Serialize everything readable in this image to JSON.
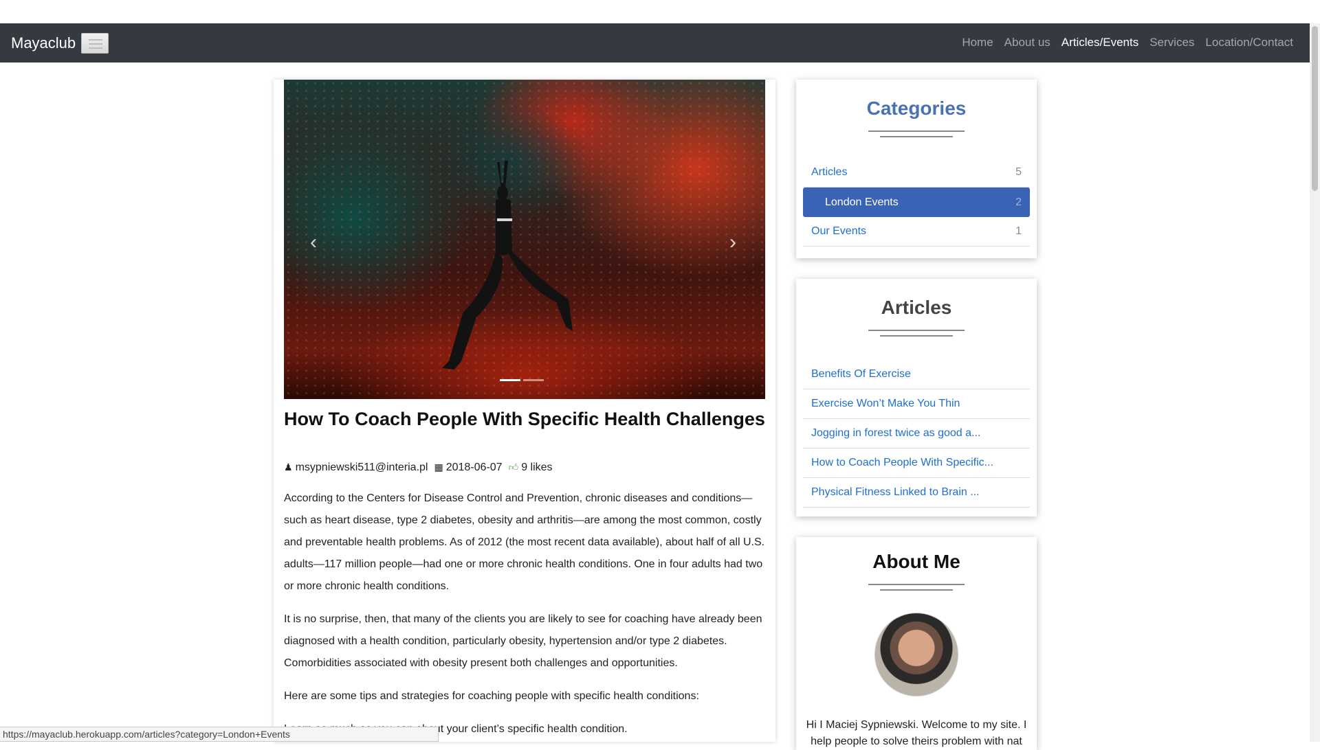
{
  "navbar": {
    "brand": "Mayaclub",
    "links": [
      {
        "label": "Home"
      },
      {
        "label": "About us"
      },
      {
        "label": "Articles/Events",
        "active": true
      },
      {
        "label": "Services"
      },
      {
        "label": "Location/Contact"
      }
    ]
  },
  "carousel": {
    "image": "yoga-pose-in-red-autumn-forest",
    "prev_icon": "chevron-left-icon",
    "next_icon": "chevron-right-icon",
    "prev_glyph": "‹",
    "next_glyph": "›",
    "active_slide": 1,
    "slide_count": 2
  },
  "post": {
    "title": "How To Coach People With Specific Health Challenges",
    "author": "msypniewski511@interia.pl",
    "date": "2018-06-07",
    "likes": "9 likes",
    "paragraphs": [
      "According to the Centers for Disease Control and Prevention, chronic diseases and conditions—such as heart disease, type 2 diabetes, obesity and arthritis—are among the most common, costly and preventable health problems. As of 2012 (the most recent data available), about half of all U.S. adults—117 million people—had one or more chronic health conditions. One in four adults had two or more chronic health conditions.",
      "It is no surprise, then, that many of the clients you are likely to see for coaching have already been diagnosed with a health condition, particularly obesity, hypertension and/or type 2 diabetes. Comorbidities associated with obesity present both challenges and opportunities.",
      "Here are some tips and strategies for coaching people with specific health conditions:",
      "Learn as much as you can about your client’s specific health condition."
    ]
  },
  "categories": {
    "title": "Categories",
    "items": [
      {
        "label": "Articles",
        "count": "5"
      },
      {
        "label": "London Events",
        "count": "2",
        "active": true
      },
      {
        "label": "Our Events",
        "count": "1"
      }
    ]
  },
  "articles": {
    "title": "Articles",
    "items": [
      {
        "label": "Benefits Of Exercise"
      },
      {
        "label": "Exercise Won’t Make You Thin"
      },
      {
        "label": "Jogging in forest twice as good a..."
      },
      {
        "label": "How to Coach People With Specific..."
      },
      {
        "label": "Physical Fitness Linked to Brain ..."
      }
    ]
  },
  "about": {
    "title": "About Me",
    "avatar": "profile-photo",
    "text": "Hi I Maciej Sypniewski. Welcome to my site. I help people to solve theirs problem with nat"
  },
  "statusbar": {
    "url": "https://mayaclub.herokuapp.com/articles?category=London+Events"
  },
  "colors": {
    "navbar_bg": "#343a40",
    "categories_title": "#4a72b0",
    "active_category_bg": "#3a62b5",
    "link": "#1f6fd0"
  }
}
